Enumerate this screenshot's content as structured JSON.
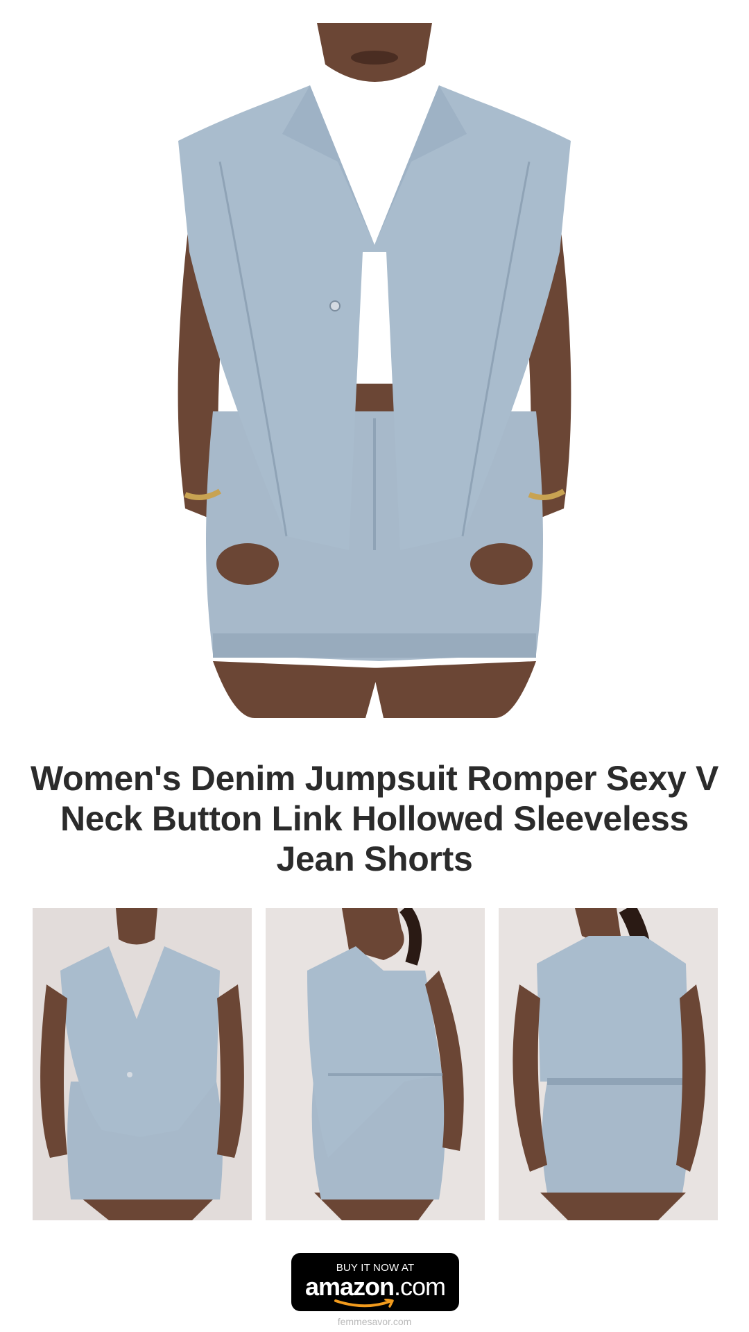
{
  "hero": {
    "image_alt": "Model wearing light wash denim vest romper, front view"
  },
  "title": "Women's Denim Jumpsuit Romper Sexy V Neck Button Link Hollowed Sleeveless Jean Shorts",
  "gallery": [
    {
      "alt": "Front view of denim romper"
    },
    {
      "alt": "Side view of denim romper"
    },
    {
      "alt": "Back view of denim romper"
    }
  ],
  "cta": {
    "top_text": "BUY IT NOW AT",
    "logo_main": "amazon",
    "logo_suffix": ".com",
    "icon": "amazon-smile-icon"
  },
  "footer": {
    "domain": "femmesavor.com"
  },
  "colors": {
    "denim": "#a9bccd",
    "denim_dark": "#8fa3b6",
    "skin": "#6b4635",
    "background": "#ffffff",
    "title": "#2b2b2b",
    "amazon_orange": "#f29b1d"
  }
}
